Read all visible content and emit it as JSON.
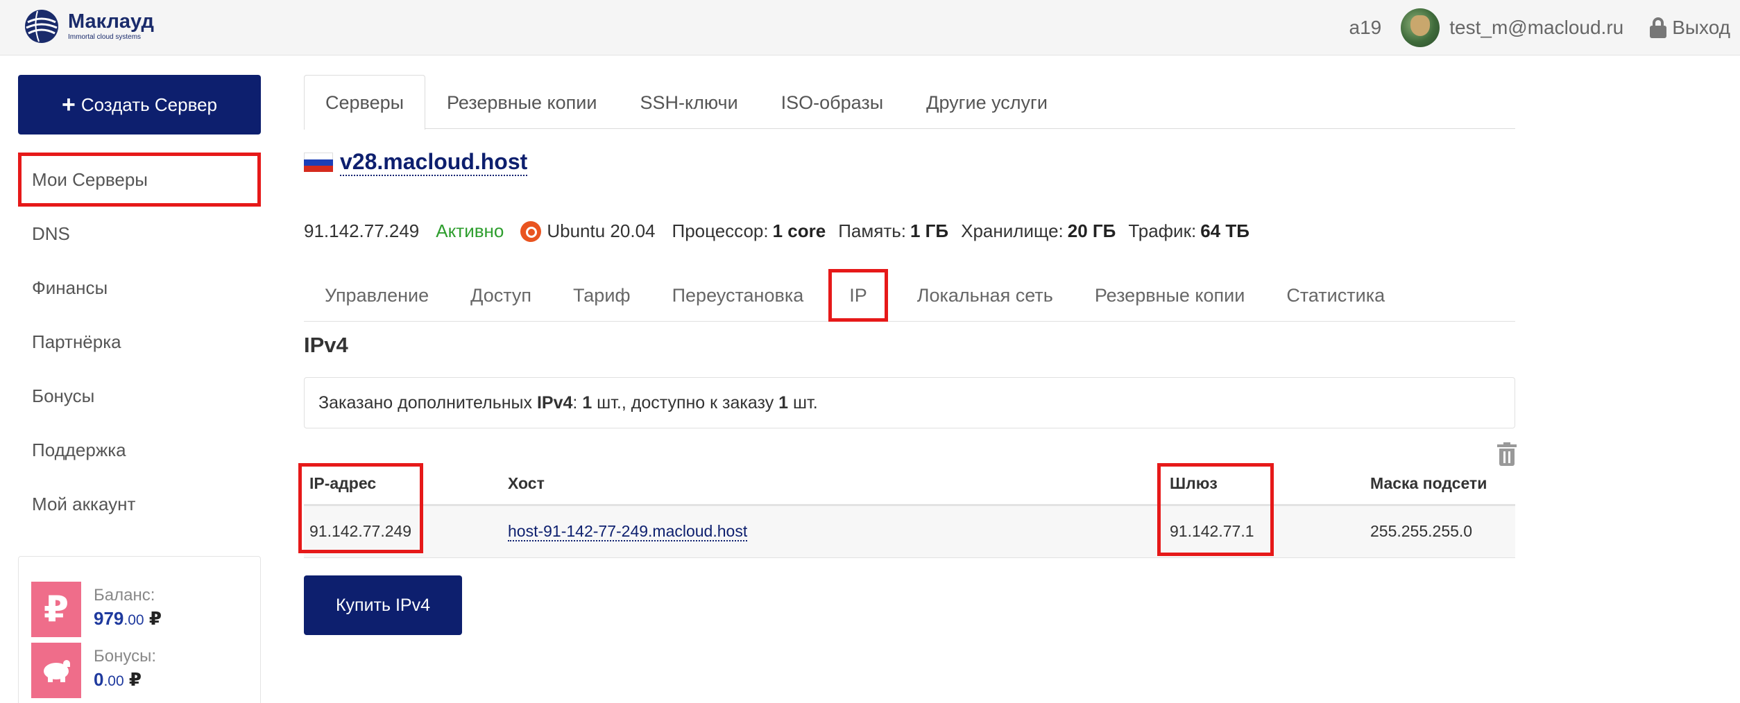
{
  "brand": {
    "name": "Маклауд",
    "tagline": "Immortal cloud systems"
  },
  "header": {
    "team": "a19",
    "user_email": "test_m@macloud.ru",
    "logout_label": "Выход"
  },
  "sidebar": {
    "create_button": "Создать Сервер",
    "items": [
      {
        "label": "Мои Серверы",
        "highlighted": true
      },
      {
        "label": "DNS"
      },
      {
        "label": "Финансы"
      },
      {
        "label": "Партнёрка"
      },
      {
        "label": "Бонусы"
      },
      {
        "label": "Поддержка"
      },
      {
        "label": "Мой аккаунт"
      }
    ],
    "balance": {
      "label": "Баланс:",
      "value_int": "979",
      "value_dec": ".00",
      "currency": "₽",
      "icon": "ruble-icon"
    },
    "bonuses": {
      "label": "Бонусы:",
      "value_int": "0",
      "value_dec": ".00",
      "currency": "₽",
      "icon": "piggy-bank-icon"
    }
  },
  "main_tabs": [
    "Серверы",
    "Резервные копии",
    "SSH-ключи",
    "ISO-образы",
    "Другие услуги"
  ],
  "server": {
    "name": "v28.macloud.host",
    "flag": "russia-flag-icon",
    "ip": "91.142.77.249",
    "status": "Активно",
    "os": "Ubuntu 20.04",
    "cpu_label": "Процессор:",
    "cpu_value": "1 core",
    "ram_label": "Память:",
    "ram_value": "1 ГБ",
    "storage_label": "Хранилище:",
    "storage_value": "20 ГБ",
    "traffic_label": "Трафик:",
    "traffic_value": "64 ТБ"
  },
  "server_tabs": [
    "Управление",
    "Доступ",
    "Тариф",
    "Переустановка",
    "IP",
    "Локальная сеть",
    "Резервные копии",
    "Статистика"
  ],
  "ipv4": {
    "title": "IPv4",
    "info_prefix": "Заказано дополнительных ",
    "info_ipv4": "IPv4",
    "info_colon": ": ",
    "info_ordered": "1",
    "info_mid": " шт., доступно к заказу ",
    "info_available": "1",
    "info_suffix": " шт.",
    "columns": [
      "IP-адрес",
      "Хост",
      "Шлюз",
      "Маска подсети"
    ],
    "rows": [
      {
        "ip": "91.142.77.249",
        "host": "host-91-142-77-249.macloud.host",
        "gateway": "91.142.77.1",
        "mask": "255.255.255.0"
      }
    ],
    "buy_button": "Купить IPv4"
  },
  "colors": {
    "primary": "#0d1f6e",
    "highlight": "#e61919",
    "active_status": "#2e9e2e",
    "balance_icon_bg": "#ef6d8a"
  }
}
